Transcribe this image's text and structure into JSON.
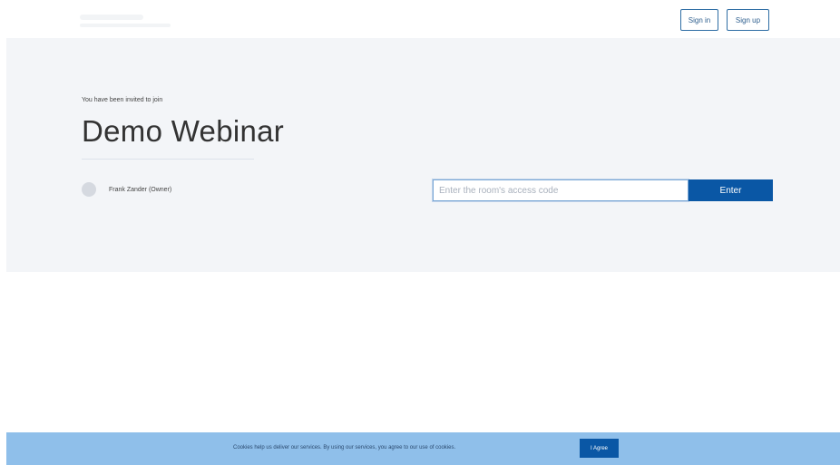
{
  "header": {
    "sign_in_label": "Sign in",
    "sign_up_label": "Sign up"
  },
  "room": {
    "invite_text": "You have been invited to join",
    "title": "Demo Webinar",
    "owner_name": "Frank Zander (Owner)",
    "access_code_placeholder": "Enter the room's access code",
    "enter_label": "Enter"
  },
  "cookie_banner": {
    "message": "Cookies help us deliver our services. By using our services, you agree to our use of cookies.",
    "agree_label": "I Agree"
  },
  "colors": {
    "primary": "#0a57a5",
    "hero_background": "#f3f5f8",
    "cookie_background": "#8fbfea"
  }
}
